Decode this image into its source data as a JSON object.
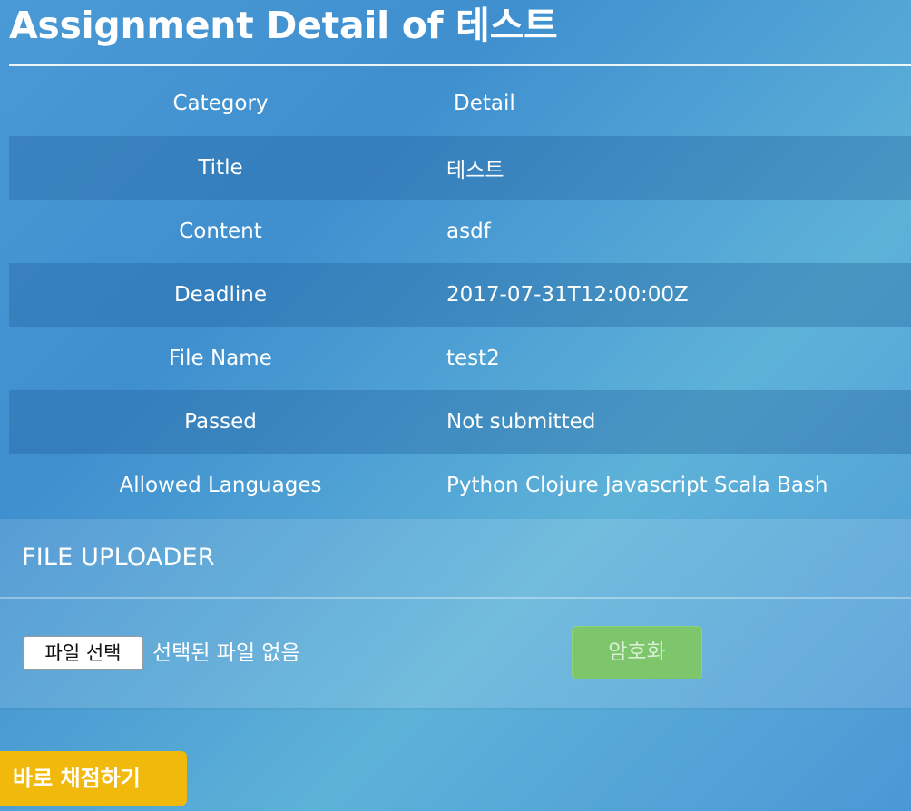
{
  "page": {
    "title": "Assignment Detail of 테스트"
  },
  "table": {
    "headers": {
      "category": "Category",
      "detail": "Detail"
    },
    "rows": [
      {
        "category": "Title",
        "detail": "테스트"
      },
      {
        "category": "Content",
        "detail": "asdf"
      },
      {
        "category": "Deadline",
        "detail": "2017-07-31T12:00:00Z"
      },
      {
        "category": "File Name",
        "detail": "test2"
      },
      {
        "category": "Passed",
        "detail": "Not submitted"
      },
      {
        "category": "Allowed Languages",
        "detail": "Python Clojure Javascript Scala Bash"
      }
    ]
  },
  "uploader": {
    "heading": "FILE UPLOADER",
    "choose_button_label": "파일 선택",
    "no_file_label": "선택된 파일 없음",
    "encrypt_button_label": "암호화"
  },
  "actions": {
    "grade_now_label": "바로 채점하기"
  },
  "colors": {
    "grade_button": "#f0b90b",
    "encrypt_button": "#7dc66b",
    "background": "#4a9ad6"
  }
}
